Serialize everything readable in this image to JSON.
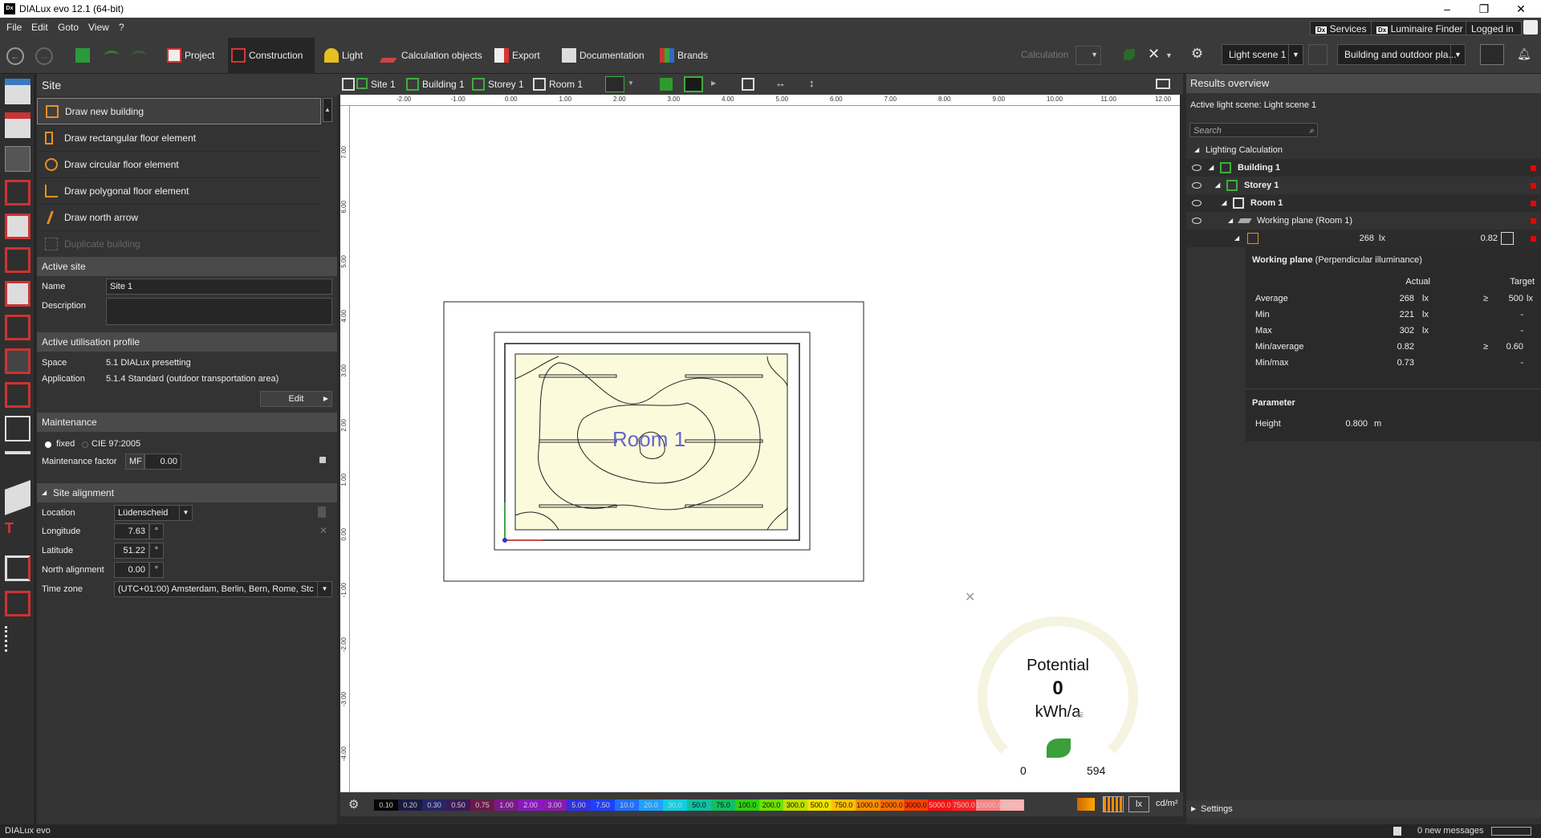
{
  "window": {
    "title": "DIALux evo 12.1  (64-bit)",
    "logo": "Dx",
    "min": "–",
    "max": "❐",
    "close": "✕"
  },
  "menu": {
    "items": [
      "File",
      "Edit",
      "Goto",
      "View",
      "?"
    ],
    "services": "Services",
    "luminaire_finder": "Luminaire Finder",
    "logged_in": "Logged in",
    "dx": "Dx"
  },
  "toolbar": {
    "tabs": [
      "Project",
      "Construction",
      "Light",
      "Calculation objects",
      "Export",
      "Documentation",
      "Brands"
    ],
    "calculation": "Calculation",
    "light_scene": "Light scene 1",
    "scene_type": "Building and outdoor pla..."
  },
  "left": {
    "site_title": "Site",
    "actions": [
      "Draw new building",
      "Draw rectangular floor element",
      "Draw circular floor element",
      "Draw polygonal floor element",
      "Draw north arrow",
      "Duplicate building"
    ],
    "active_site": {
      "title": "Active site",
      "name_label": "Name",
      "name_value": "Site 1",
      "desc_label": "Description",
      "desc_value": ""
    },
    "profile": {
      "title": "Active utilisation profile",
      "space_label": "Space",
      "space_value": "5.1 DIALux presetting",
      "app_label": "Application",
      "app_value": "5.1.4 Standard (outdoor transportation area)",
      "edit": "Edit"
    },
    "maintenance": {
      "title": "Maintenance",
      "fixed": "fixed",
      "cie": "CIE 97:2005",
      "factor_label": "Maintenance factor",
      "mf": "MF",
      "mf_value": "0.00"
    },
    "alignment": {
      "title": "Site alignment",
      "location_label": "Location",
      "location_value": "Lüdenscheid",
      "lon_label": "Longitude",
      "lon_value": "7.63",
      "lat_label": "Latitude",
      "lat_value": "51.22",
      "north_label": "North alignment",
      "north_value": "0.00",
      "deg": "°",
      "tz_label": "Time zone",
      "tz_value": "(UTC+01:00) Amsterdam, Berlin, Bern, Rome, Stc"
    }
  },
  "view": {
    "breadcrumb": [
      "Site 1",
      "Building 1",
      "Storey 1",
      "Room 1"
    ],
    "ruler_top": [
      "-2.00",
      "-1.00",
      "0.00",
      "1.00",
      "2.00",
      "3.00",
      "4.00",
      "5.00",
      "6.00",
      "7.00",
      "8.00",
      "9.00",
      "10.00",
      "11.00",
      "12.00"
    ],
    "ruler_left": [
      "7.00",
      "6.00",
      "5.00",
      "4.00",
      "3.00",
      "2.00",
      "1.00",
      "0.00",
      "-1.00",
      "-2.00",
      "-3.00",
      "-4.00"
    ],
    "room_label": "Room 1",
    "potential": {
      "title": "Potential",
      "value": "0",
      "unit": "kWh/a",
      "min": "0",
      "max": "594"
    },
    "legend": {
      "values": [
        "0.10",
        "0.20",
        "0.30",
        "0.50",
        "0.75",
        "1.00",
        "2.00",
        "3.00",
        "5.00",
        "7.50",
        "10.0",
        "20.0",
        "30.0",
        "50.0",
        "75.0",
        "100.0",
        "200.0",
        "300.0",
        "500.0",
        "750.0",
        "1000.0",
        "2000.0",
        "3000.0",
        "5000.0",
        "7500.0",
        "10000.0",
        "15000"
      ],
      "colors": [
        "#050505",
        "#1a1a40",
        "#262668",
        "#3a1a5a",
        "#6a1a4a",
        "#7a1a8a",
        "#8a18c0",
        "#8a1ab0",
        "#3030e0",
        "#2040ff",
        "#2070ff",
        "#20a0ff",
        "#10d0e0",
        "#10c0a0",
        "#10c060",
        "#30d010",
        "#70e000",
        "#c0e000",
        "#f0e000",
        "#ffc000",
        "#ff9000",
        "#ff7000",
        "#ff4000",
        "#ff1010",
        "#ff2020",
        "#ff8080",
        "#ffb0b0"
      ],
      "unit_lx": "lx",
      "unit_cd": "cd/m²"
    }
  },
  "right": {
    "title": "Results overview",
    "active_scene": "Active light scene: Light scene 1",
    "search_placeholder": "Search",
    "tree": [
      "Lighting Calculation",
      "Building 1",
      "Storey 1",
      "Room 1",
      "Working plane (Room 1)"
    ],
    "wp_avg": "268",
    "wp_unit": "lx",
    "wp_ratio": "0.82",
    "detail": {
      "title": "Working plane",
      "subtitle": "(Perpendicular illuminance)",
      "actual": "Actual",
      "target": "Target",
      "rows": [
        {
          "label": "Average",
          "actual": "268",
          "unit": "lx",
          "target_op": "≥",
          "target": "500",
          "target_unit": "lx"
        },
        {
          "label": "Min",
          "actual": "221",
          "unit": "lx",
          "target_op": "",
          "target": "-",
          "target_unit": ""
        },
        {
          "label": "Max",
          "actual": "302",
          "unit": "lx",
          "target_op": "",
          "target": "-",
          "target_unit": ""
        },
        {
          "label": "Min/average",
          "actual": "0.82",
          "unit": "",
          "target_op": "≥",
          "target": "0.60",
          "target_unit": ""
        },
        {
          "label": "Min/max",
          "actual": "0.73",
          "unit": "",
          "target_op": "",
          "target": "-",
          "target_unit": ""
        }
      ]
    },
    "parameter": {
      "title": "Parameter",
      "height_label": "Height",
      "height_value": "0.800",
      "height_unit": "m"
    },
    "settings": "Settings"
  },
  "status": {
    "app": "DIALux evo",
    "messages": "0 new messages"
  }
}
